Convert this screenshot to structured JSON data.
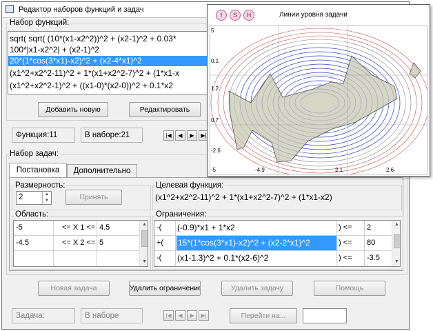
{
  "window": {
    "title": "Редактор наборов функций и задач"
  },
  "functions_group": {
    "label": "Набор функций:",
    "items": [
      "sqrt( sqrt( (10*(x1-x2^2))^2 + (x2-1)^2 + 0.03*",
      "100*|x1-x2^2| + (x2-1)^2",
      "20*(1*cos(3*x1)-x2)^2 + (x2-4*x1)^2",
      "(x1^2+x2^2-11)^2 + 1*(x1+x2^2-7)^2 + (1*x1-x",
      "(x1^2+x2^2-1)^2 + ((x1-0)*(x2-0))^2 + 0.1*x2"
    ],
    "selected_index": 2,
    "add_button": "Добавить новую",
    "edit_button": "Редактировать"
  },
  "status": {
    "function": "Функция:11",
    "in_set": "В наборе:21"
  },
  "tasks_group": {
    "label": "Набор задач:",
    "tabs": [
      "Постановка",
      "Дополнительно"
    ],
    "dimension": {
      "label": "Размерность:",
      "value": "2",
      "accept_button": "Принять"
    },
    "target": {
      "label": "Целевая функция:",
      "value": "(x1^2+x2^2-11)^2 + 1*(x1+x2^2-7)^2 + (1*x1-x2)"
    },
    "area": {
      "label": "Область:",
      "rows": [
        {
          "low": "-5",
          "mid": "<= X 1 <=",
          "high": "4.5"
        },
        {
          "low": "-4.5",
          "mid": "<= X 2 <=",
          "high": "5"
        }
      ]
    },
    "constraints": {
      "label": "Ограничения:",
      "rows": [
        {
          "sign": "-(",
          "expr": "(-0.9)*x1 + 1*x2",
          "op": ") <=",
          "value": "2"
        },
        {
          "sign": "+(",
          "expr": "15*(1*cos(3*x1)-x2)^2 + (x2-2*x1)^2",
          "op": ") <=",
          "value": "80"
        },
        {
          "sign": "-(",
          "expr": "(x1-1.3)^2 + 0.1*(x2-6)^2",
          "op": ") <=",
          "value": "-3.5"
        }
      ],
      "selected_index": 1
    }
  },
  "actions": {
    "new_task": "Новая задача",
    "delete_constraint": "Удалить ограничение",
    "delete_task": "Удалить задачу",
    "help": "Помощь"
  },
  "bottom_status": {
    "task": "Задача:",
    "in_set": "В наборе",
    "goto": "Перейти на..."
  },
  "plot_window": {
    "title": "Линии уровня задачи",
    "tool_labels": [
      "f",
      "S",
      "H"
    ],
    "y_ticks": [
      "5",
      "0.1",
      "1.2",
      "0.7",
      "-2.6",
      "-5"
    ],
    "x_ticks": [
      "-4.9",
      "2.1",
      "2.6"
    ]
  }
}
